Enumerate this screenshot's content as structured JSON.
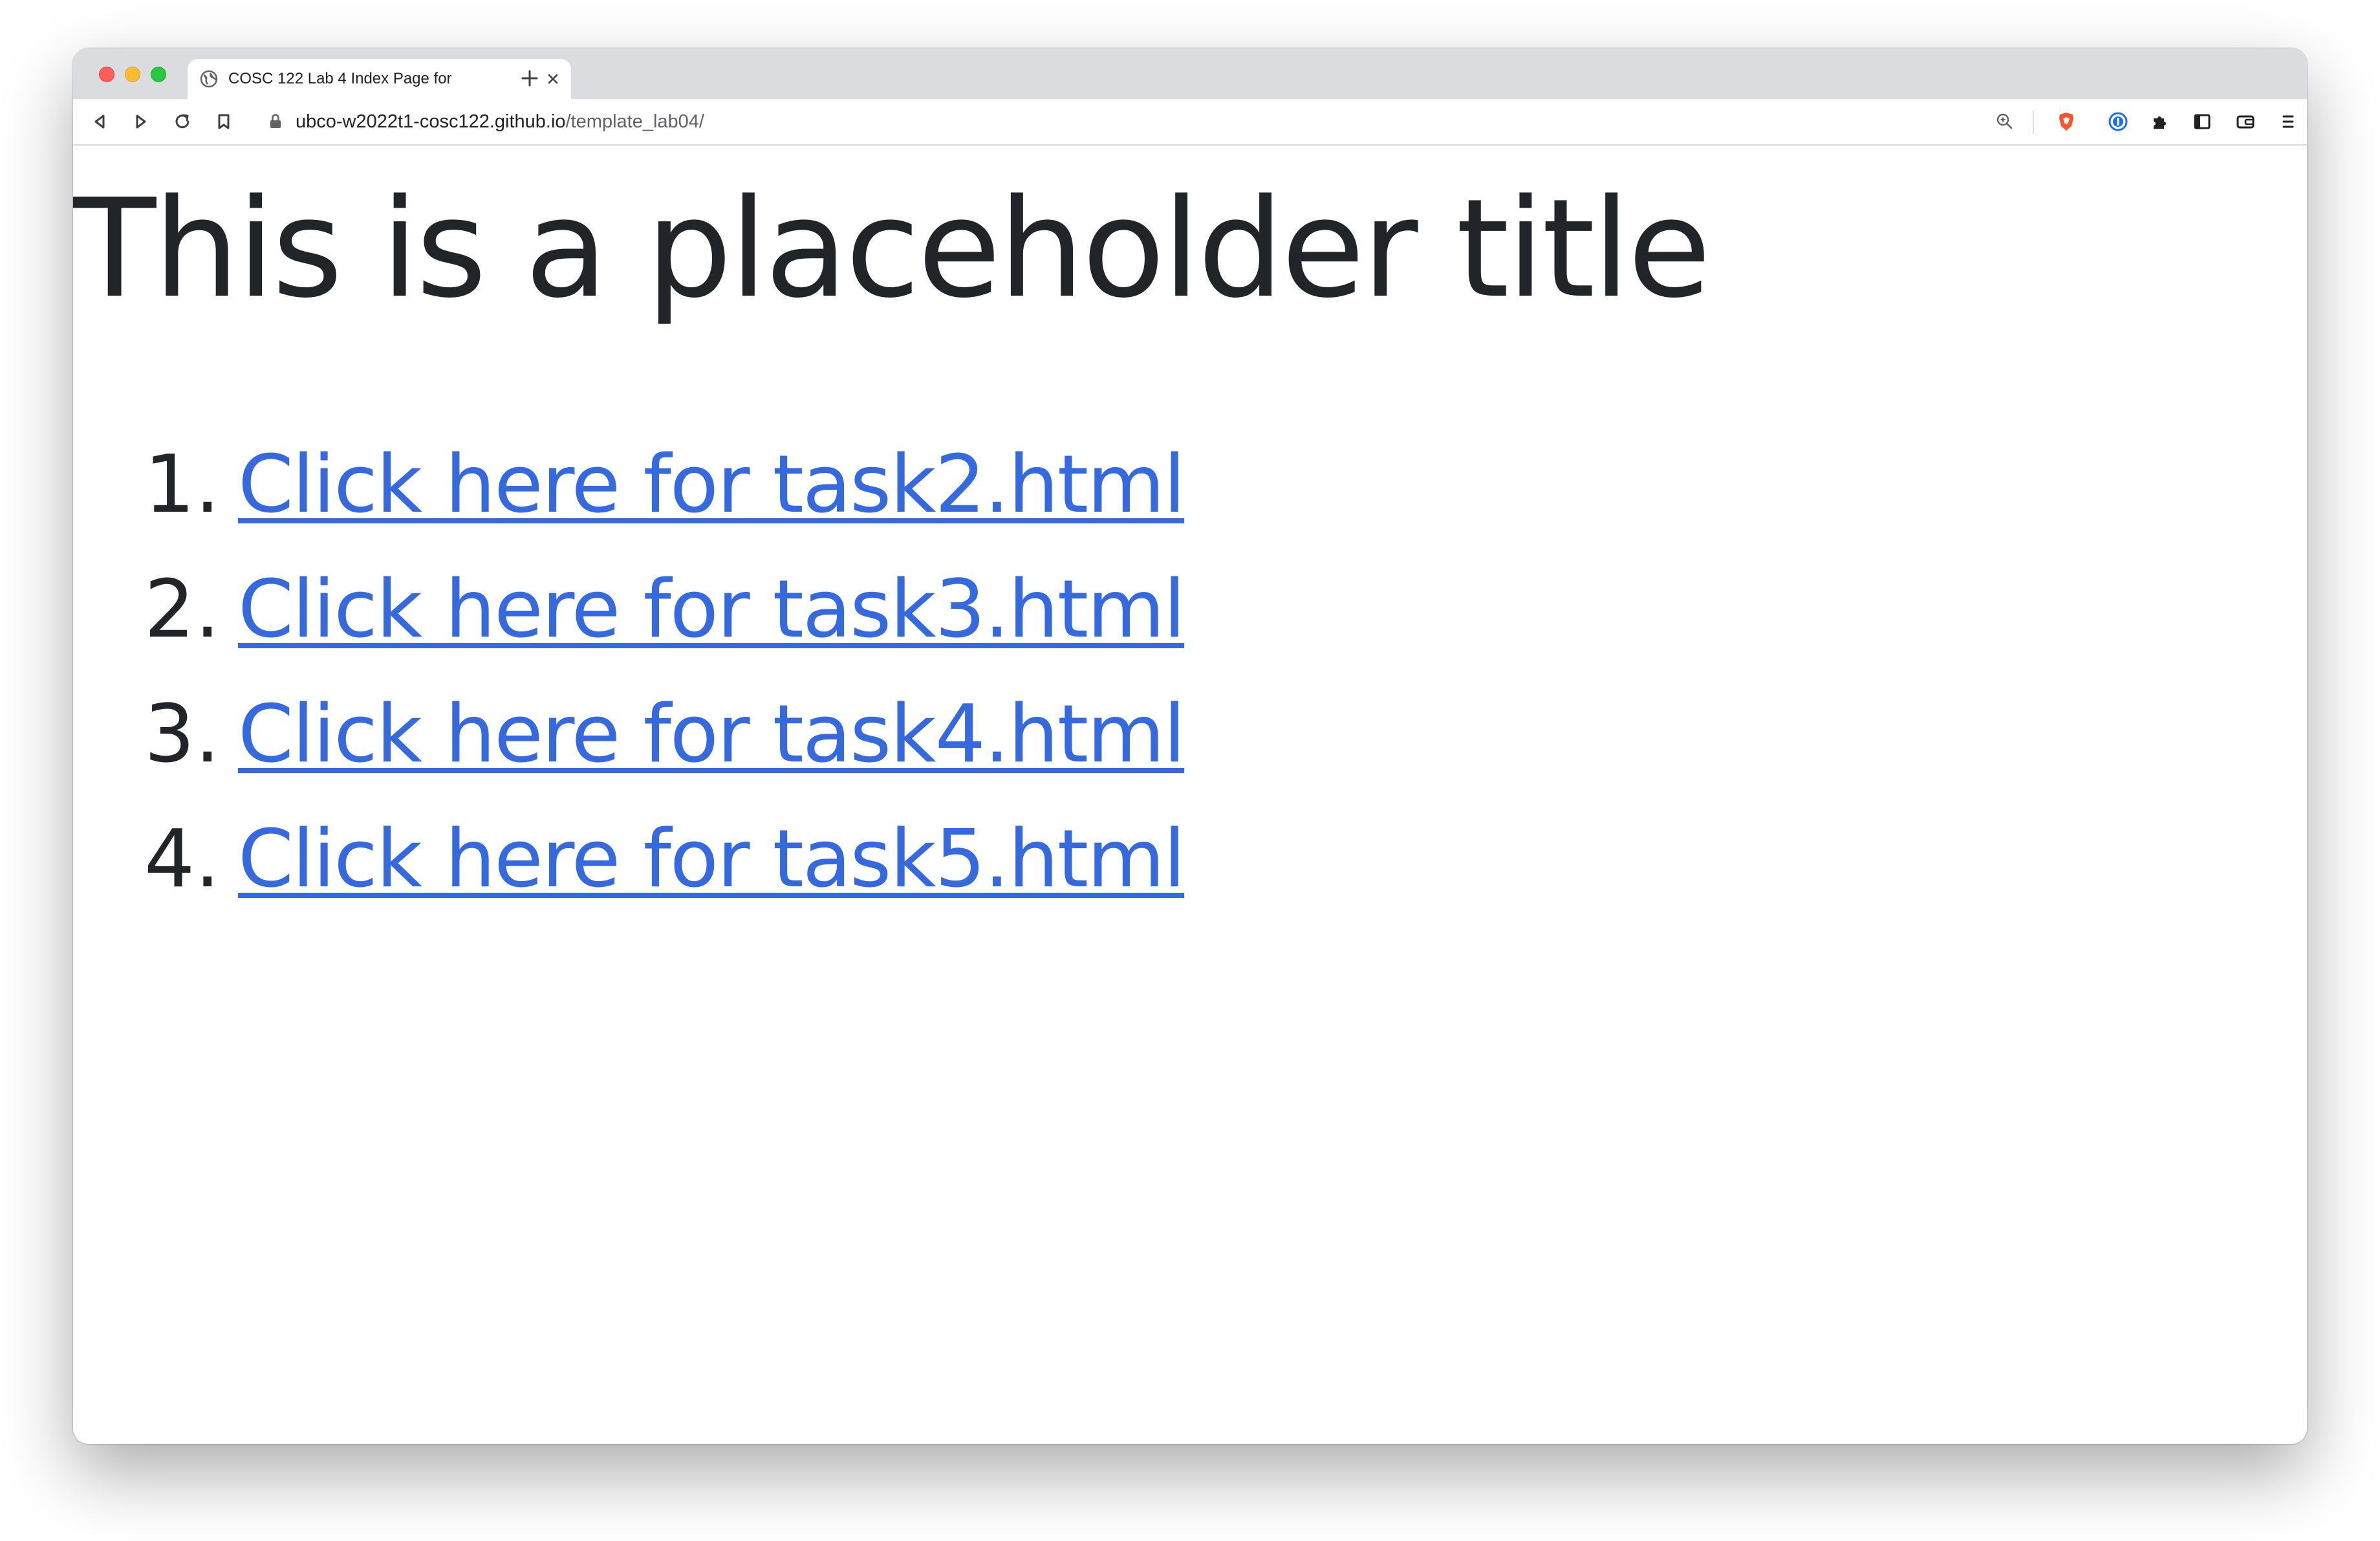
{
  "browser": {
    "tab": {
      "title": "COSC 122 Lab 4 Index Page for"
    },
    "address": {
      "host": "ubco-w2022t1-cosc122.github.io",
      "path": "/template_lab04/"
    },
    "icons": {
      "back": "back-icon",
      "forward": "forward-icon",
      "reload": "reload-icon",
      "bookmark": "bookmark-icon",
      "lock": "lock-icon",
      "zoom": "zoom-icon",
      "brave_shields": "brave-shield-icon",
      "password_manager": "password-manager-icon",
      "extensions": "extensions-icon",
      "sidebar": "sidebar-icon",
      "wallet": "wallet-icon",
      "menu": "menu-icon"
    },
    "colors": {
      "tabstrip": "#dadce0",
      "brave_orange": "#fb542b",
      "password_blue": "#1a73e8"
    }
  },
  "page": {
    "title": "This is a placeholder title",
    "tasks": [
      {
        "number": "1.",
        "label": "Click here for task2.html"
      },
      {
        "number": "2.",
        "label": "Click here for task3.html"
      },
      {
        "number": "3.",
        "label": "Click here for task4.html"
      },
      {
        "number": "4.",
        "label": "Click here for task5.html"
      }
    ],
    "colors": {
      "text": "#212529",
      "link": "#3569e0"
    }
  }
}
